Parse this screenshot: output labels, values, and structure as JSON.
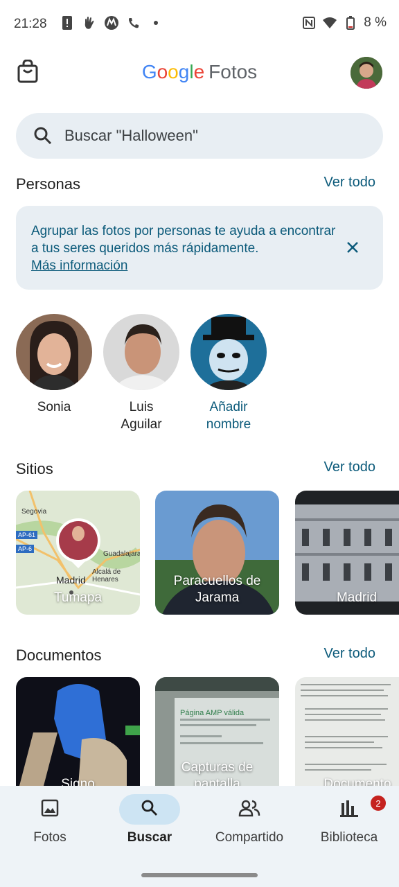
{
  "status": {
    "time": "21:28",
    "battery": "8 %"
  },
  "app": {
    "brand_google": "Google",
    "brand_product": "Fotos"
  },
  "search": {
    "placeholder": "Buscar \"Halloween\""
  },
  "people": {
    "title": "Personas",
    "see_all": "Ver todo",
    "info_text": "Agrupar las fotos por personas te ayuda a encontrar a tus seres queridos más rápidamente.",
    "info_link": "Más información",
    "items": [
      {
        "name": "Sonia"
      },
      {
        "name": "Luis\nAguilar"
      },
      {
        "name": "Añadir\nnombre"
      }
    ]
  },
  "places": {
    "title": "Sitios",
    "see_all": "Ver todo",
    "items": [
      {
        "label": "Tumapa"
      },
      {
        "label": "Paracuellos de\nJarama"
      },
      {
        "label": "Madrid"
      }
    ],
    "map_labels": {
      "segovia": "Segovia",
      "a61": "AP-61",
      "a6": "AP-6",
      "guadalajara": "Guadalajara",
      "alcala": "Alcalá de\nHenares",
      "madrid": "Madrid"
    }
  },
  "documents": {
    "title": "Documentos",
    "see_all": "Ver todo",
    "items": [
      {
        "label": "Signo"
      },
      {
        "label": "Capturas de\npantalla"
      },
      {
        "label": "Documento"
      }
    ],
    "doc_heading": "Página AMP válida"
  },
  "nav": {
    "items": [
      {
        "label": "Fotos",
        "icon": "photo-icon"
      },
      {
        "label": "Buscar",
        "icon": "search-icon"
      },
      {
        "label": "Compartido",
        "icon": "people-icon"
      },
      {
        "label": "Biblioteca",
        "icon": "library-icon",
        "badge": "2"
      }
    ]
  },
  "colors": {
    "accent": "#0b5a7a",
    "chip_bg": "#e8eef3",
    "nav_bg": "#eef3f7",
    "active_pill": "#cde4f3",
    "badge": "#c5221f"
  }
}
